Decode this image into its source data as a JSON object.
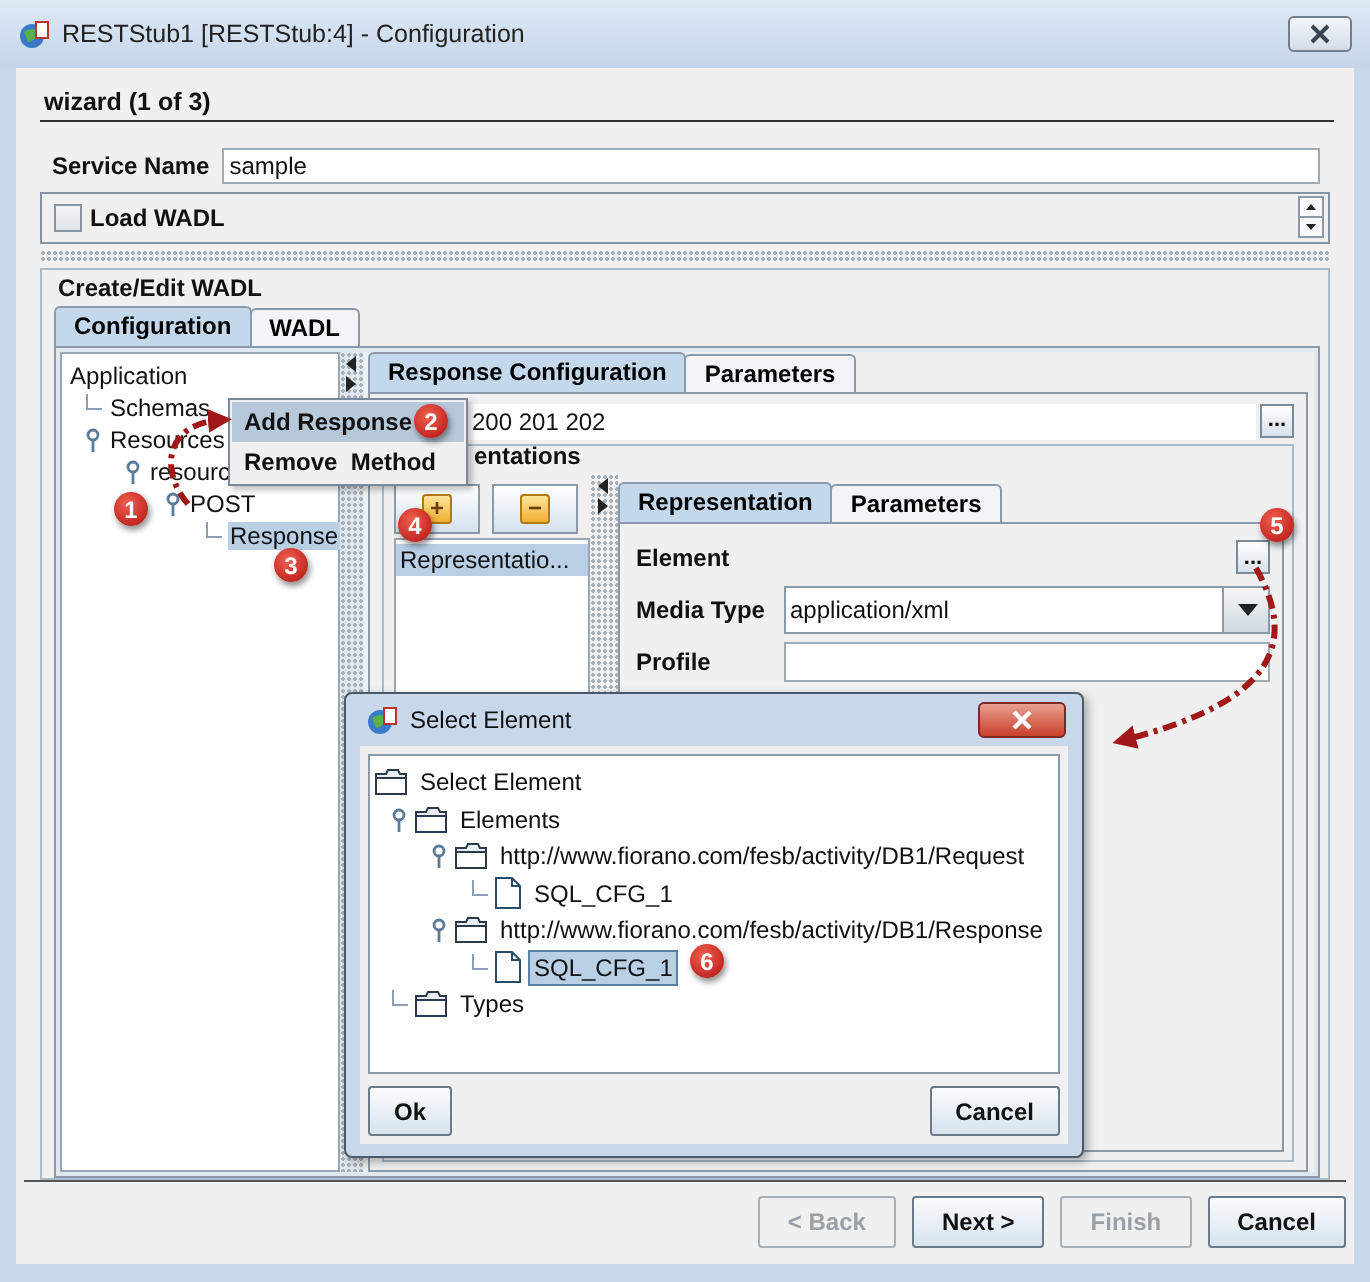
{
  "window": {
    "title": "RESTStub1 [RESTStub:4] - Configuration"
  },
  "wizard": {
    "title": "wizard (1 of 3)"
  },
  "service_name": {
    "label": "Service Name",
    "value": "sample"
  },
  "load_wadl": {
    "label": "Load WADL",
    "checked": false
  },
  "wadl_group": {
    "title": "Create/Edit WADL"
  },
  "tabs": [
    {
      "label": "Configuration",
      "selected": true
    },
    {
      "label": "WADL",
      "selected": false
    }
  ],
  "tree": [
    {
      "label": "Application",
      "selected": false,
      "children": [
        {
          "label": "Schemas",
          "selected": false
        },
        {
          "label": "Resources",
          "selected": false,
          "children": [
            {
              "label": "resourc",
              "selected": false,
              "children": [
                {
                  "label": "POST",
                  "selected": false,
                  "children": [
                    {
                      "label": "Response",
                      "selected": true
                    }
                  ]
                }
              ]
            }
          ]
        }
      ]
    }
  ],
  "response_tabs": [
    {
      "label": "Response Configuration",
      "selected": true
    },
    {
      "label": "Parameters",
      "selected": false
    }
  ],
  "status_codes": {
    "value": "200 201 202",
    "button": "..."
  },
  "representations": {
    "title": "entations",
    "add": "+",
    "remove": "−",
    "items": [
      {
        "label": "Representatio...",
        "selected": true
      }
    ]
  },
  "representation_tabs": [
    {
      "label": "Representation",
      "selected": true
    },
    {
      "label": "Parameters",
      "selected": false
    }
  ],
  "element": {
    "label": "Element",
    "button": "..."
  },
  "media_type": {
    "label": "Media Type",
    "value": "application/xml"
  },
  "profile": {
    "label": "Profile"
  },
  "context_menu": {
    "items": [
      {
        "label": "Add Response",
        "selected": true
      },
      {
        "label": "Remove  Method",
        "selected": false
      }
    ]
  },
  "dialog": {
    "title": "Select Element",
    "tree": [
      {
        "label": "Select Element",
        "kind": "folder",
        "selected": false,
        "children": [
          {
            "label": "Elements",
            "kind": "folder",
            "selected": false,
            "children": [
              {
                "label": "http://www.fiorano.com/fesb/activity/DB1/Request",
                "kind": "folder",
                "selected": false,
                "children": [
                  {
                    "label": "SQL_CFG_1",
                    "kind": "file",
                    "selected": false
                  }
                ]
              },
              {
                "label": "http://www.fiorano.com/fesb/activity/DB1/Response",
                "kind": "folder",
                "selected": false,
                "children": [
                  {
                    "label": "SQL_CFG_1",
                    "kind": "file",
                    "selected": true
                  }
                ]
              }
            ]
          },
          {
            "label": "Types",
            "kind": "folder",
            "selected": false
          }
        ]
      }
    ],
    "buttons": [
      "Ok",
      "Cancel"
    ]
  },
  "buttons": [
    {
      "label": "< Back",
      "disabled": true
    },
    {
      "label": "Next >",
      "disabled": false
    },
    {
      "label": "Finish",
      "disabled": true
    },
    {
      "label": "Cancel",
      "disabled": false
    }
  ],
  "callouts": [
    "1",
    "2",
    "3",
    "4",
    "5",
    "6"
  ]
}
